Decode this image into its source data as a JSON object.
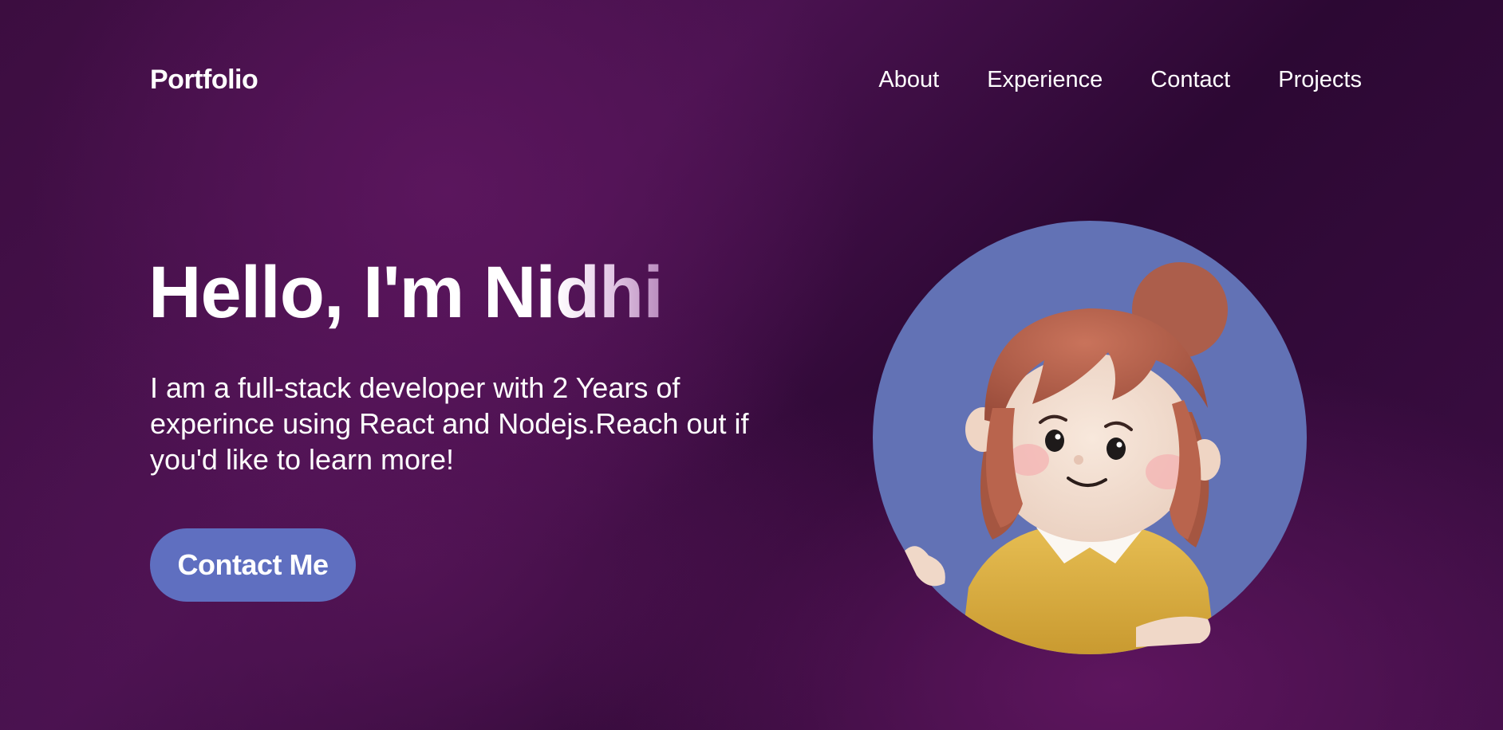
{
  "nav": {
    "brand": "Portfolio",
    "links": [
      {
        "label": "About"
      },
      {
        "label": "Experience"
      },
      {
        "label": "Contact"
      },
      {
        "label": "Projects"
      }
    ]
  },
  "hero": {
    "greeting": "Hello, I'm ",
    "name_solid": "Ni",
    "name_fade": "dhi",
    "description": "I am a full-stack developer with 2 Years of experince using React and Nodejs.Reach out if you'd like to learn more!",
    "cta_label": "Contact Me"
  },
  "avatar": {
    "icon": "cartoon-girl-avatar",
    "circle_color": "#6272b5"
  },
  "colors": {
    "background": "#3c0d40",
    "accent": "#5f6fc0",
    "text": "#ffffff"
  }
}
